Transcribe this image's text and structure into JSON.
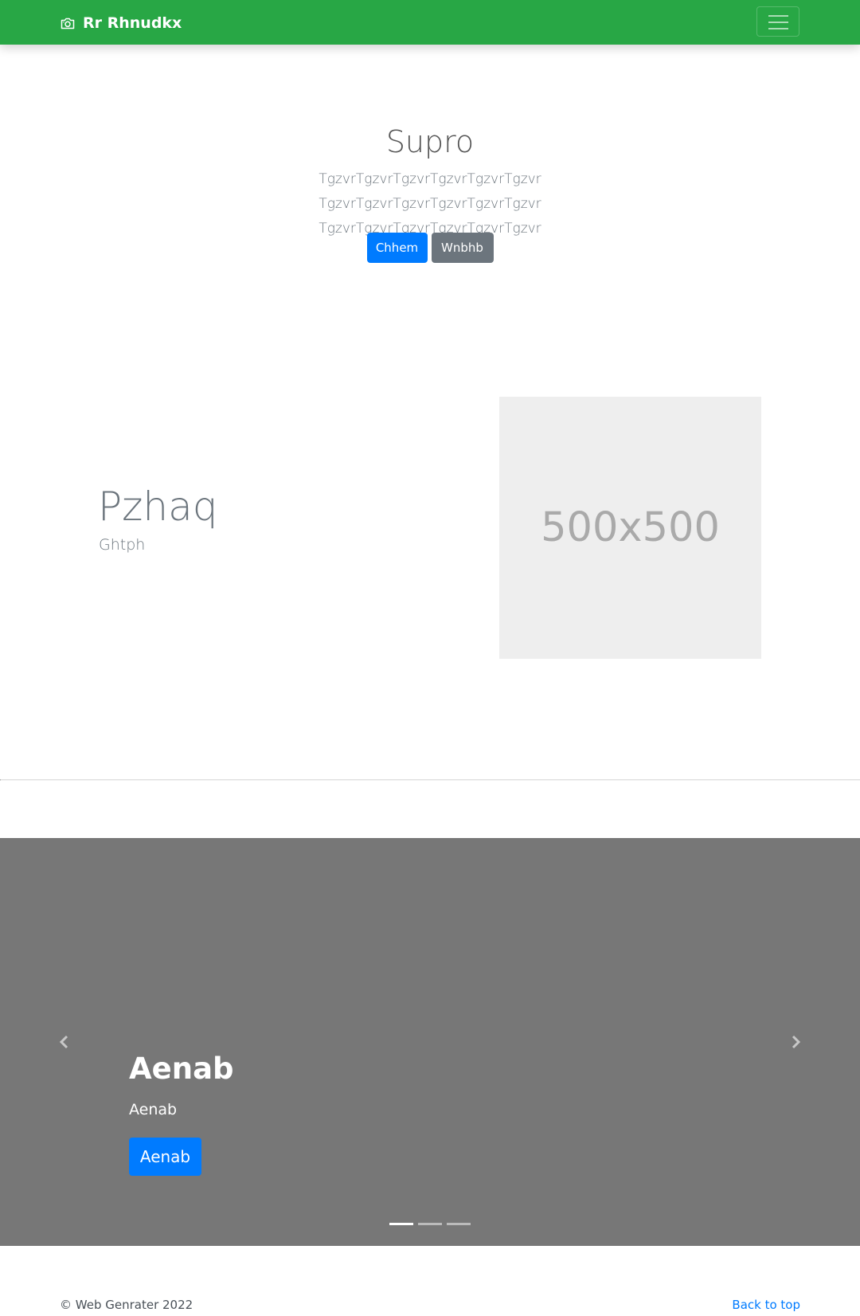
{
  "navbar": {
    "brand": "Rr Rhnudkx",
    "brand_icon": "camera-icon",
    "toggler_icon": "hamburger-icon",
    "background_color": "#28a745"
  },
  "hero": {
    "title": "Supro",
    "lead": "TgzvrTgzvrTgzvrTgzvrTgzvrTgzvr TgzvrTgzvrTgzvrTgzvrTgzvrTgzvr TgzvrTgzvrTgzvrTgzvrTgzvrTgzvr",
    "primary_button": "Chhem",
    "secondary_button": "Wnbhb"
  },
  "feature": {
    "heading": "Pzhaq",
    "subheading": "Ghtph",
    "image_placeholder": "500x500"
  },
  "carousel": {
    "background_color": "#777777",
    "prev_icon": "chevron-left-icon",
    "next_icon": "chevron-right-icon",
    "caption": {
      "title": "Aenab",
      "text": "Aenab",
      "button": "Aenab"
    },
    "slide_count": 3,
    "active_slide": 1
  },
  "footer": {
    "copyright": "© Web Genrater 2022",
    "back_to_top": "Back to top"
  },
  "colors": {
    "primary": "#007bff",
    "secondary": "#6c757d",
    "success": "#28a745"
  }
}
